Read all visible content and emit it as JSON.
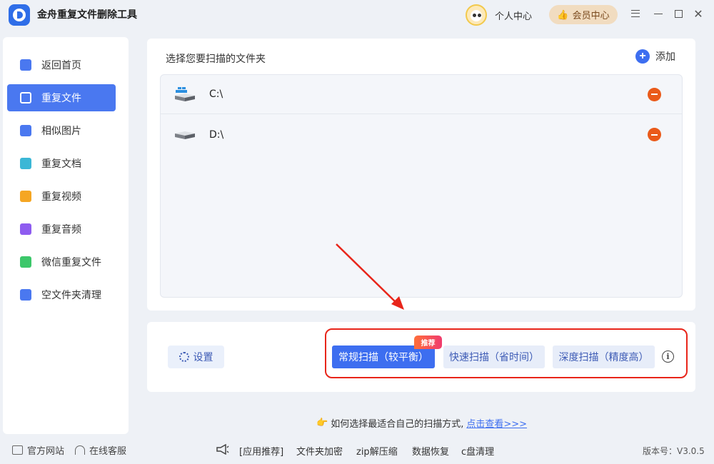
{
  "app": {
    "title": "金舟重复文件删除工具"
  },
  "header": {
    "personal_center": "个人中心",
    "vip_center": "会员中心"
  },
  "sidebar": {
    "items": [
      {
        "label": "返回首页",
        "icon": "home-icon",
        "color": "#4a78f0"
      },
      {
        "label": "重复文件",
        "icon": "folder-icon",
        "color": "#ffffff"
      },
      {
        "label": "相似图片",
        "icon": "image-icon",
        "color": "#4a78f0"
      },
      {
        "label": "重复文档",
        "icon": "document-icon",
        "color": "#3bb7d6"
      },
      {
        "label": "重复视频",
        "icon": "video-icon",
        "color": "#f5a623"
      },
      {
        "label": "重复音频",
        "icon": "audio-icon",
        "color": "#8e5cf0"
      },
      {
        "label": "微信重复文件",
        "icon": "wechat-icon",
        "color": "#3cc76a"
      },
      {
        "label": "空文件夹清理",
        "icon": "empty-folder-icon",
        "color": "#4a78f0"
      }
    ],
    "active_index": 1
  },
  "folders": {
    "heading": "选择您要扫描的文件夹",
    "add_label": "添加",
    "list": [
      {
        "path": "C:\\",
        "icon": "windows-drive-icon"
      },
      {
        "path": "D:\\",
        "icon": "drive-icon"
      }
    ]
  },
  "scan": {
    "settings_label": "设置",
    "badge": "推荐",
    "normal": "常规扫描（较平衡）",
    "fast": "快速扫描（省时间）",
    "deep": "深度扫描（精度高）"
  },
  "hint": {
    "text": "如何选择最适合自己的扫描方式,",
    "link": "点击查看>>>"
  },
  "footer": {
    "official_site": "官方网站",
    "online_service": "在线客服",
    "app_recommend": "[应用推荐]",
    "links": [
      "文件夹加密",
      "zip解压缩",
      "数据恢复",
      "c盘清理"
    ],
    "version": "版本号：V3.0.5"
  },
  "colors": {
    "accent": "#3d6ef0",
    "annotation": "#e8251a",
    "remove": "#ea5a1a"
  }
}
